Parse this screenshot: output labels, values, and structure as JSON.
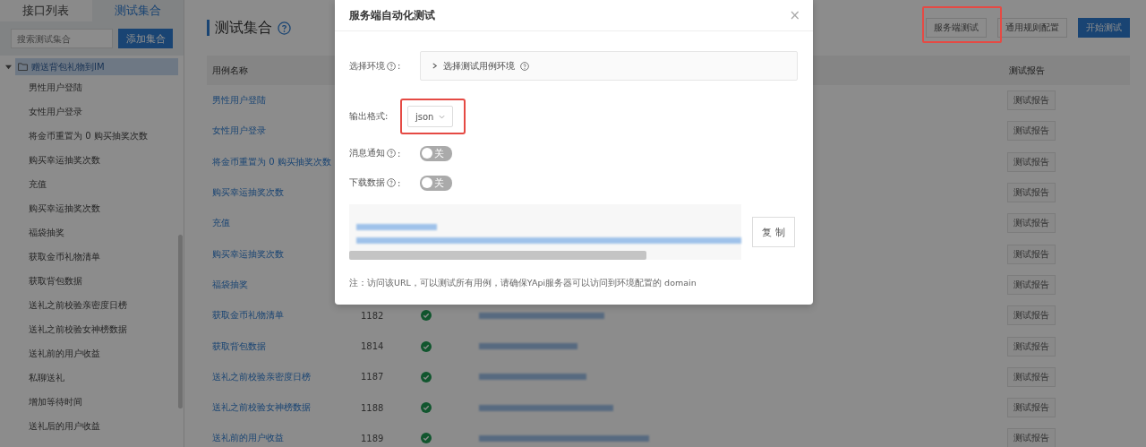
{
  "sidebar": {
    "tabs": [
      {
        "label": "接口列表",
        "selected": false
      },
      {
        "label": "测试集合",
        "selected": true
      }
    ],
    "search": {
      "placeholder": "搜索测试集合"
    },
    "add_button": "添加集合",
    "tree": [
      {
        "label": "赠送背包礼物到IM",
        "expanded": true,
        "selected": true,
        "children": [
          {
            "label": "男性用户登陆",
            "selected": false
          },
          {
            "label": "女性用户登录",
            "selected": false
          },
          {
            "label": "将金币重置为 0 购买抽奖次数",
            "selected": false
          },
          {
            "label": "购买幸运抽奖次数",
            "selected": false
          },
          {
            "label": "充值",
            "selected": false
          },
          {
            "label": "购买幸运抽奖次数",
            "selected": false
          },
          {
            "label": "福袋抽奖",
            "selected": false
          },
          {
            "label": "获取金币礼物清单",
            "selected": false
          },
          {
            "label": "获取背包数据",
            "selected": false
          },
          {
            "label": "送礼之前校验亲密度日榜",
            "selected": false
          },
          {
            "label": "送礼之前校验女神榜数据",
            "selected": false
          },
          {
            "label": "送礼前的用户收益",
            "selected": false
          },
          {
            "label": "私聊送礼",
            "selected": false
          },
          {
            "label": "增加等待时间",
            "selected": false
          },
          {
            "label": "送礼后的用户收益",
            "selected": false
          }
        ]
      }
    ]
  },
  "main": {
    "title": "测试集合",
    "buttons": [
      {
        "label": "服务端测试",
        "kind": "default",
        "highlighted": true
      },
      {
        "label": "通用规则配置",
        "kind": "default",
        "highlighted": false
      },
      {
        "label": "开始测试",
        "kind": "primary",
        "highlighted": false
      }
    ],
    "table": {
      "columns": [
        "用例名称",
        "测试报告"
      ],
      "rows": [
        {
          "name": "男性用户登陆",
          "report": "测试报告"
        },
        {
          "name": "女性用户登录",
          "report": "测试报告"
        },
        {
          "name": "将金币重置为 0 购买抽奖次数",
          "report": "测试报告"
        },
        {
          "name": "购买幸运抽奖次数",
          "report": "测试报告"
        },
        {
          "name": "充值",
          "report": "测试报告"
        },
        {
          "name": "购买幸运抽奖次数",
          "report": "测试报告"
        },
        {
          "name": "福袋抽奖",
          "report": "测试报告"
        },
        {
          "name": "获取金币礼物清单",
          "id": "1182",
          "passed": true,
          "report": "测试报告"
        },
        {
          "name": "获取背包数据",
          "id": "1814",
          "passed": true,
          "report": "测试报告"
        },
        {
          "name": "送礼之前校验亲密度日榜",
          "id": "1187",
          "passed": true,
          "report": "测试报告"
        },
        {
          "name": "送礼之前校验女神榜数据",
          "id": "1188",
          "passed": true,
          "report": "测试报告"
        },
        {
          "name": "送礼前的用户收益",
          "id": "1189",
          "passed": true,
          "report": "测试报告"
        }
      ]
    }
  },
  "modal": {
    "title": "服务端自动化测试",
    "close": "×",
    "env": {
      "label": "选择环境",
      "colon": ":",
      "panel": "选择测试用例环境",
      "expanded": false
    },
    "format": {
      "label": "输出格式:",
      "value": "json",
      "highlighted": true
    },
    "switches": [
      {
        "label": "消息通知",
        "colon": ":",
        "text": "关",
        "on": false
      },
      {
        "label": "下载数据",
        "colon": ":",
        "text": "关",
        "on": false
      }
    ],
    "copy_button": "复 制",
    "note": "注：访问该URL，可以测试所有用例，请确保YApi服务器可以访问到环境配置的 domain"
  }
}
